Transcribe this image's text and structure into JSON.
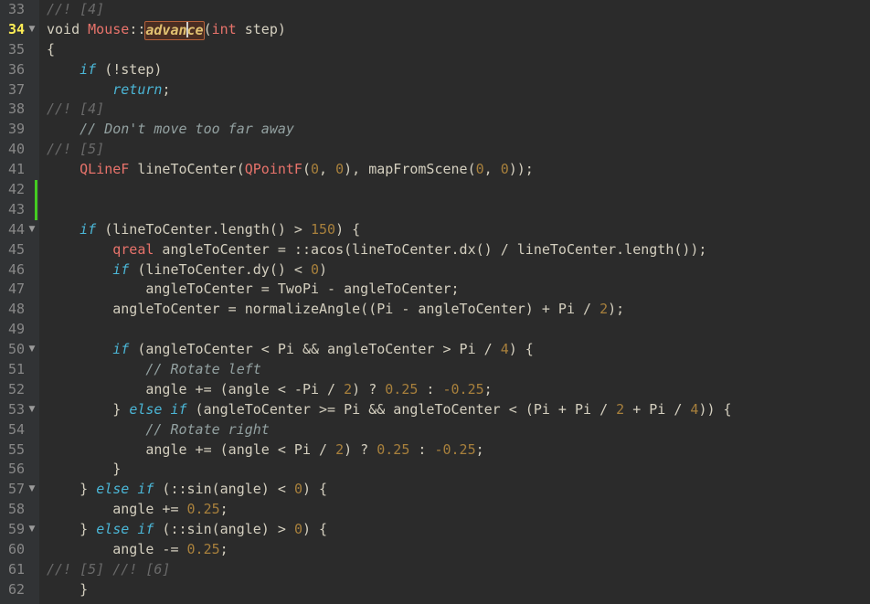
{
  "editor": {
    "app_kind": "code-editor",
    "language": "C++",
    "current_line": 34,
    "caret_line": 34,
    "caret_column_label": "advan|ce",
    "colors": {
      "background": "#2b2b2b",
      "gutter_background": "#313335",
      "line_number": "#888888",
      "current_line_number": "#ffee55",
      "keyword": "#4bb6d6",
      "type": "#e8736b",
      "number": "#a8803c",
      "comment": "#93a1a1",
      "doc_comment": "#6a6a6a",
      "plain": "#d4cfbf",
      "vcs_added_marker": "#44cc22",
      "rename_box_fill": "#4a2d22",
      "rename_box_border": "#b4603a",
      "rename_box_text": "#e0c070",
      "caret": "#cfcfcf"
    },
    "gutter": {
      "fold_arrow_glyph": "▼",
      "fold_arrow_lines": [
        34,
        44,
        50,
        53,
        57,
        59
      ],
      "vcs_added_lines": [
        42,
        43
      ]
    },
    "lines": [
      {
        "number": 33,
        "tokens": [
          {
            "text": "//! [4]",
            "kind": "doccom"
          }
        ]
      },
      {
        "number": 34,
        "tokens": [
          {
            "text": "void",
            "kind": "plain"
          },
          {
            "text": " ",
            "kind": "plain"
          },
          {
            "text": "Mouse",
            "kind": "type"
          },
          {
            "text": "::",
            "kind": "punct"
          },
          {
            "text": "advan",
            "kind": "rename-start"
          },
          {
            "text": "",
            "kind": "caret"
          },
          {
            "text": "ce",
            "kind": "rename-end"
          },
          {
            "text": "(",
            "kind": "punct"
          },
          {
            "text": "int",
            "kind": "type"
          },
          {
            "text": " step)",
            "kind": "plain"
          }
        ]
      },
      {
        "number": 35,
        "tokens": [
          {
            "text": "{",
            "kind": "plain"
          }
        ]
      },
      {
        "number": 36,
        "tokens": [
          {
            "text": "    ",
            "kind": "plain"
          },
          {
            "text": "if",
            "kind": "keyword"
          },
          {
            "text": " (!step)",
            "kind": "plain"
          }
        ]
      },
      {
        "number": 37,
        "tokens": [
          {
            "text": "        ",
            "kind": "plain"
          },
          {
            "text": "return",
            "kind": "keyword"
          },
          {
            "text": ";",
            "kind": "plain"
          }
        ]
      },
      {
        "number": 38,
        "tokens": [
          {
            "text": "//! [4]",
            "kind": "doccom"
          }
        ]
      },
      {
        "number": 39,
        "tokens": [
          {
            "text": "    ",
            "kind": "plain"
          },
          {
            "text": "// Don't move too far away",
            "kind": "comment"
          }
        ]
      },
      {
        "number": 40,
        "tokens": [
          {
            "text": "//! [5]",
            "kind": "doccom"
          }
        ]
      },
      {
        "number": 41,
        "tokens": [
          {
            "text": "    ",
            "kind": "plain"
          },
          {
            "text": "QLineF",
            "kind": "type"
          },
          {
            "text": " lineToCenter(",
            "kind": "plain"
          },
          {
            "text": "QPointF",
            "kind": "type"
          },
          {
            "text": "(",
            "kind": "plain"
          },
          {
            "text": "0",
            "kind": "number"
          },
          {
            "text": ", ",
            "kind": "plain"
          },
          {
            "text": "0",
            "kind": "number"
          },
          {
            "text": "), mapFromScene(",
            "kind": "plain"
          },
          {
            "text": "0",
            "kind": "number"
          },
          {
            "text": ", ",
            "kind": "plain"
          },
          {
            "text": "0",
            "kind": "number"
          },
          {
            "text": "));",
            "kind": "plain"
          }
        ]
      },
      {
        "number": 42,
        "tokens": []
      },
      {
        "number": 43,
        "tokens": []
      },
      {
        "number": 44,
        "tokens": [
          {
            "text": "    ",
            "kind": "plain"
          },
          {
            "text": "if",
            "kind": "keyword"
          },
          {
            "text": " (lineToCenter.length() > ",
            "kind": "plain"
          },
          {
            "text": "150",
            "kind": "number"
          },
          {
            "text": ") {",
            "kind": "plain"
          }
        ]
      },
      {
        "number": 45,
        "tokens": [
          {
            "text": "        ",
            "kind": "plain"
          },
          {
            "text": "qreal",
            "kind": "type"
          },
          {
            "text": " angleToCenter = ::acos(lineToCenter.dx() / lineToCenter.length());",
            "kind": "plain"
          }
        ]
      },
      {
        "number": 46,
        "tokens": [
          {
            "text": "        ",
            "kind": "plain"
          },
          {
            "text": "if",
            "kind": "keyword"
          },
          {
            "text": " (lineToCenter.dy() < ",
            "kind": "plain"
          },
          {
            "text": "0",
            "kind": "number"
          },
          {
            "text": ")",
            "kind": "plain"
          }
        ]
      },
      {
        "number": 47,
        "tokens": [
          {
            "text": "            angleToCenter = TwoPi - angleToCenter;",
            "kind": "plain"
          }
        ]
      },
      {
        "number": 48,
        "tokens": [
          {
            "text": "        angleToCenter = normalizeAngle((Pi - angleToCenter) + Pi / ",
            "kind": "plain"
          },
          {
            "text": "2",
            "kind": "number"
          },
          {
            "text": ");",
            "kind": "plain"
          }
        ]
      },
      {
        "number": 49,
        "tokens": []
      },
      {
        "number": 50,
        "tokens": [
          {
            "text": "        ",
            "kind": "plain"
          },
          {
            "text": "if",
            "kind": "keyword"
          },
          {
            "text": " (angleToCenter < Pi && angleToCenter > Pi / ",
            "kind": "plain"
          },
          {
            "text": "4",
            "kind": "number"
          },
          {
            "text": ") {",
            "kind": "plain"
          }
        ]
      },
      {
        "number": 51,
        "tokens": [
          {
            "text": "            ",
            "kind": "plain"
          },
          {
            "text": "// Rotate left",
            "kind": "comment"
          }
        ]
      },
      {
        "number": 52,
        "tokens": [
          {
            "text": "            angle += (angle < -Pi / ",
            "kind": "plain"
          },
          {
            "text": "2",
            "kind": "number"
          },
          {
            "text": ") ? ",
            "kind": "plain"
          },
          {
            "text": "0.25",
            "kind": "number"
          },
          {
            "text": " : ",
            "kind": "plain"
          },
          {
            "text": "-0.25",
            "kind": "number"
          },
          {
            "text": ";",
            "kind": "plain"
          }
        ]
      },
      {
        "number": 53,
        "tokens": [
          {
            "text": "        } ",
            "kind": "plain"
          },
          {
            "text": "else",
            "kind": "keyword"
          },
          {
            "text": " ",
            "kind": "plain"
          },
          {
            "text": "if",
            "kind": "keyword"
          },
          {
            "text": " (angleToCenter >= Pi && angleToCenter < (Pi + Pi / ",
            "kind": "plain"
          },
          {
            "text": "2",
            "kind": "number"
          },
          {
            "text": " + Pi / ",
            "kind": "plain"
          },
          {
            "text": "4",
            "kind": "number"
          },
          {
            "text": ")) {",
            "kind": "plain"
          }
        ]
      },
      {
        "number": 54,
        "tokens": [
          {
            "text": "            ",
            "kind": "plain"
          },
          {
            "text": "// Rotate right",
            "kind": "comment"
          }
        ]
      },
      {
        "number": 55,
        "tokens": [
          {
            "text": "            angle += (angle < Pi / ",
            "kind": "plain"
          },
          {
            "text": "2",
            "kind": "number"
          },
          {
            "text": ") ? ",
            "kind": "plain"
          },
          {
            "text": "0.25",
            "kind": "number"
          },
          {
            "text": " : ",
            "kind": "plain"
          },
          {
            "text": "-0.25",
            "kind": "number"
          },
          {
            "text": ";",
            "kind": "plain"
          }
        ]
      },
      {
        "number": 56,
        "tokens": [
          {
            "text": "        }",
            "kind": "plain"
          }
        ]
      },
      {
        "number": 57,
        "tokens": [
          {
            "text": "    } ",
            "kind": "plain"
          },
          {
            "text": "else",
            "kind": "keyword"
          },
          {
            "text": " ",
            "kind": "plain"
          },
          {
            "text": "if",
            "kind": "keyword"
          },
          {
            "text": " (::sin(angle) < ",
            "kind": "plain"
          },
          {
            "text": "0",
            "kind": "number"
          },
          {
            "text": ") {",
            "kind": "plain"
          }
        ]
      },
      {
        "number": 58,
        "tokens": [
          {
            "text": "        angle += ",
            "kind": "plain"
          },
          {
            "text": "0.25",
            "kind": "number"
          },
          {
            "text": ";",
            "kind": "plain"
          }
        ]
      },
      {
        "number": 59,
        "tokens": [
          {
            "text": "    } ",
            "kind": "plain"
          },
          {
            "text": "else",
            "kind": "keyword"
          },
          {
            "text": " ",
            "kind": "plain"
          },
          {
            "text": "if",
            "kind": "keyword"
          },
          {
            "text": " (::sin(angle) > ",
            "kind": "plain"
          },
          {
            "text": "0",
            "kind": "number"
          },
          {
            "text": ") {",
            "kind": "plain"
          }
        ]
      },
      {
        "number": 60,
        "tokens": [
          {
            "text": "        angle -= ",
            "kind": "plain"
          },
          {
            "text": "0.25",
            "kind": "number"
          },
          {
            "text": ";",
            "kind": "plain"
          }
        ]
      },
      {
        "number": 61,
        "tokens": [
          {
            "text": "//! [5] //! [6]",
            "kind": "doccom"
          }
        ]
      },
      {
        "number": 62,
        "tokens": [
          {
            "text": "    }",
            "kind": "plain"
          }
        ]
      }
    ]
  }
}
